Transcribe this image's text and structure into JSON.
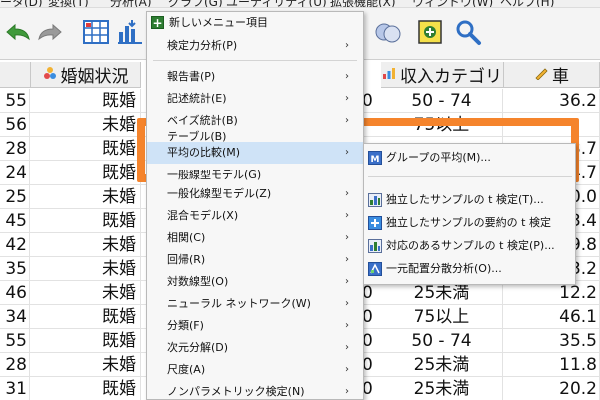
{
  "menubar": {
    "items": [
      "ータ(D)",
      "変換(T)",
      "分析(A)",
      "グラフ(G)",
      "ユーティリティ(U)",
      "拡張機能(X)",
      "ウィンドウ(W)",
      "ヘルプ(H)"
    ]
  },
  "toolbar": {
    "icons": [
      "undo-icon",
      "redo-icon",
      "goto-case-icon",
      "variables-icon",
      "run-descriptives-icon",
      "split-file-icon",
      "value-labels-icon",
      "use-sets-icon",
      "search-icon"
    ]
  },
  "grid": {
    "headers": {
      "marital": "婚姻状況",
      "income": "収入カテゴリ",
      "car": "車"
    },
    "rows": [
      {
        "id": "55",
        "marital": "既婚",
        "income": "50 - 74",
        "car": "36.2"
      },
      {
        "id": "56",
        "marital": "未婚",
        "income": "75以上",
        "car": ""
      },
      {
        "id": "28",
        "marital": "既婚",
        "income": "",
        "car": "3.7"
      },
      {
        "id": "24",
        "marital": "既婚",
        "income": "",
        "car": "4.7"
      },
      {
        "id": "25",
        "marital": "未婚",
        "income": "",
        "car": "0.0"
      },
      {
        "id": "45",
        "marital": "既婚",
        "income": "",
        "car": "3.4"
      },
      {
        "id": "42",
        "marital": "未婚",
        "income": "",
        "car": "9.8"
      },
      {
        "id": "35",
        "marital": "未婚",
        "income": "",
        "car": "3.2"
      },
      {
        "id": "46",
        "marital": "未婚",
        "income": "25未満",
        "car": "12.2"
      },
      {
        "id": "34",
        "marital": "既婚",
        "income": "75以上",
        "car": "46.1"
      },
      {
        "id": "55",
        "marital": "既婚",
        "income": "50 - 74",
        "car": "35.5"
      },
      {
        "id": "28",
        "marital": "未婚",
        "income": "25未満",
        "car": "11.8"
      },
      {
        "id": "31",
        "marital": "既婚",
        "income": "25未満",
        "car": "20.2"
      }
    ],
    "zero_values": [
      "0",
      "0",
      "0",
      "0",
      "0",
      "0"
    ]
  },
  "analyze_menu": {
    "items": [
      {
        "label": "新しいメニュー項目",
        "arrow": ""
      },
      {
        "label": "検定力分析(P)",
        "arrow": "›"
      },
      {
        "label": "報告書(P)",
        "arrow": "›"
      },
      {
        "label": "記述統計(E)",
        "arrow": "›"
      },
      {
        "label": "ベイズ統計(B)",
        "arrow": "›"
      },
      {
        "label": "テーブル(B)",
        "arrow": "›"
      },
      {
        "label": "平均の比較(M)",
        "arrow": "›"
      },
      {
        "label": "一般線型モデル(G)",
        "arrow": "›"
      },
      {
        "label": "一般化線型モデル(Z)",
        "arrow": "›"
      },
      {
        "label": "混合モデル(X)",
        "arrow": "›"
      },
      {
        "label": "相関(C)",
        "arrow": "›"
      },
      {
        "label": "回帰(R)",
        "arrow": "›"
      },
      {
        "label": "対数線型(O)",
        "arrow": "›"
      },
      {
        "label": "ニューラル ネットワーク(W)",
        "arrow": "›"
      },
      {
        "label": "分類(F)",
        "arrow": "›"
      },
      {
        "label": "次元分解(D)",
        "arrow": "›"
      },
      {
        "label": "尺度(A)",
        "arrow": "›"
      },
      {
        "label": "ノンパラメトリック検定(N)",
        "arrow": "›"
      }
    ]
  },
  "compare_means_submenu": {
    "items": [
      {
        "label": "グループの平均(M)...",
        "icon": "means-icon"
      },
      {
        "label": "独立したサンプルの t 検定(T)...",
        "icon": "independent-t-icon"
      },
      {
        "label": "独立したサンプルの要約の t 検定",
        "icon": "summary-t-icon"
      },
      {
        "label": "対応のあるサンプルの t 検定(P)...",
        "icon": "paired-t-icon"
      },
      {
        "label": "一元配置分散分析(O)...",
        "icon": "oneway-anova-icon"
      }
    ]
  },
  "colors": {
    "highlight_frame": "#f5842c",
    "menu_hover": "#cfe3f7",
    "accent_blue": "#2f6fc4"
  }
}
